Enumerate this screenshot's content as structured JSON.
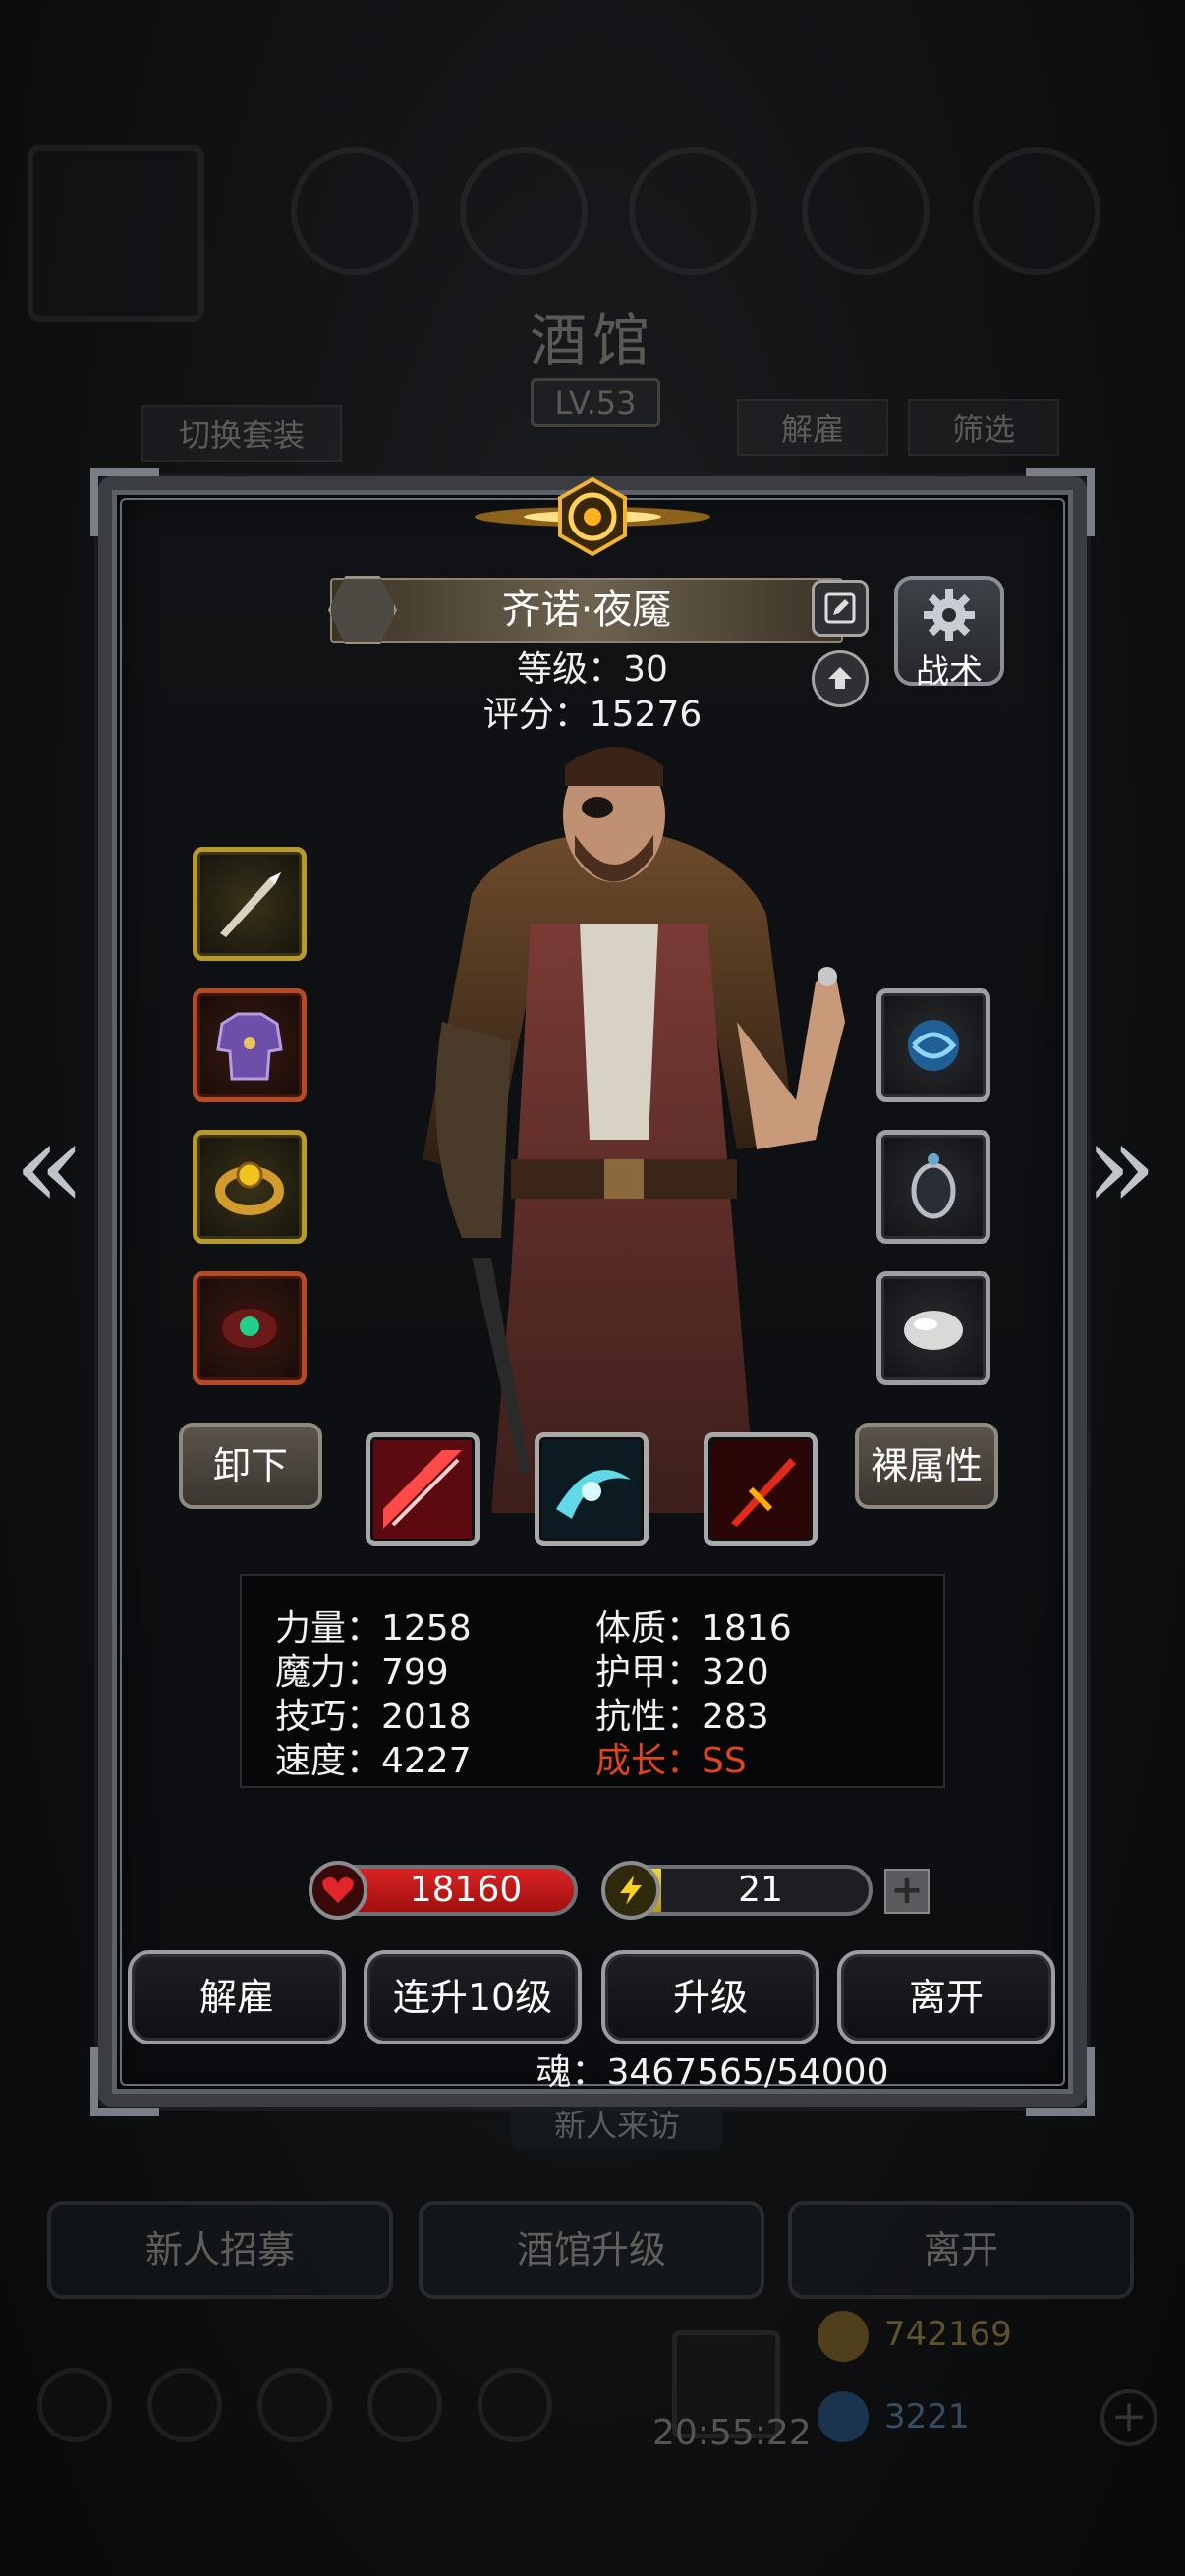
{
  "background": {
    "title": "酒馆",
    "level": "LV.53",
    "switch_outfit": "切换套装",
    "dismiss_tab": "解雇",
    "filter_tab": "筛选",
    "visitor_label": "新人来访",
    "buttons": [
      "新人招募",
      "酒馆升级",
      "离开"
    ],
    "gold": "742169",
    "gems": "3221",
    "clock": "20:55:22"
  },
  "hero": {
    "name": "齐诺·夜魇",
    "level_line": "等级：30",
    "score_line": "评分：15276",
    "tactics_label": "战术",
    "unequip_label": "卸下",
    "base_attr_label": "裸属性"
  },
  "equipment": {
    "left": [
      {
        "icon": "spear-icon",
        "rarity": "gold"
      },
      {
        "icon": "armor-icon",
        "rarity": "red"
      },
      {
        "icon": "ring-icon",
        "rarity": "gold"
      },
      {
        "icon": "gem-amulet-icon",
        "rarity": "red"
      }
    ],
    "right": [
      {
        "icon": "blue-orb-icon",
        "rarity": "grey"
      },
      {
        "icon": "mirror-icon",
        "rarity": "grey"
      },
      {
        "icon": "stone-icon",
        "rarity": "grey"
      }
    ]
  },
  "skills": [
    "slash-skill-icon",
    "whirl-skill-icon",
    "blade-skill-icon"
  ],
  "stats": {
    "strength": "力量：1258",
    "constitution": "体质：1816",
    "magic": "魔力：799",
    "armor": "护甲：320",
    "skill": "技巧：2018",
    "resistance": "抗性：283",
    "speed": "速度：4227",
    "growth": "成长：SS"
  },
  "bars": {
    "hp": "18160",
    "energy": "21",
    "energy_fill_fraction": 0.2,
    "plus": "+"
  },
  "actions": {
    "dismiss": "解雇",
    "level_up_10": "连升10级",
    "level_up": "升级",
    "leave": "离开"
  },
  "soul_line": "魂：3467565/54000",
  "colors": {
    "growth": "#e0441f",
    "hp": "#d92323",
    "energy": "#f0d436",
    "frame": "#3b3d42"
  }
}
